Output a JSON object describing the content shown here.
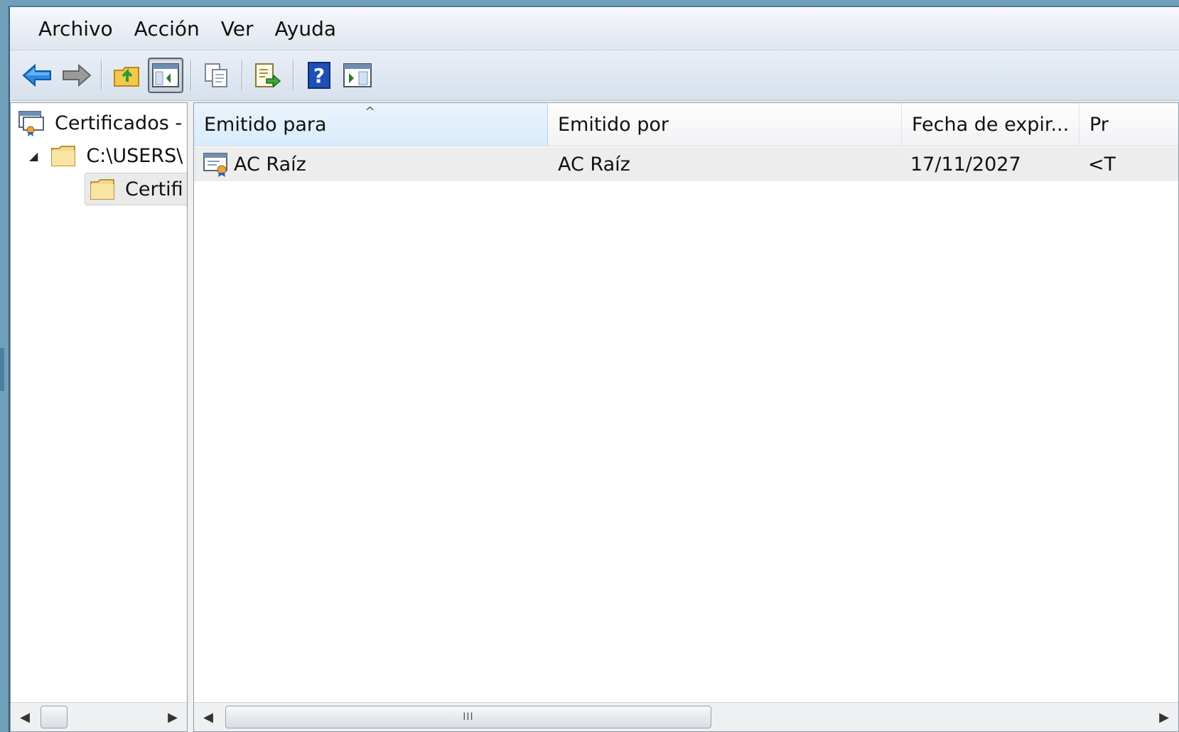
{
  "menu": [
    "Archivo",
    "Acción",
    "Ver",
    "Ayuda"
  ],
  "toolbar": {
    "icons": [
      "back-arrow-icon",
      "forward-arrow-icon",
      "up-folder-icon",
      "show-hide-tree-icon",
      "copy-icon",
      "export-list-icon",
      "help-icon",
      "show-hide-action-pane-icon"
    ]
  },
  "tree": {
    "root_label": "Certificados -",
    "store_label": "C:\\USERS\\",
    "folder_label": "Certifi"
  },
  "list": {
    "columns": [
      "Emitido para",
      "Emitido por",
      "Fecha de expir...",
      "Pr"
    ],
    "sort_indicator": "^",
    "rows": [
      {
        "issued_to": "AC Raíz",
        "issued_by": "AC Raíz",
        "expiration": "17/11/2027",
        "purpose": "<T"
      }
    ]
  },
  "scroll": {
    "thumb_grip": "III",
    "left_arrow": "◀",
    "right_arrow": "▶"
  },
  "colors": {
    "accent_blue": "#1e6fd1",
    "folder_yellow": "#f2d27a",
    "sorted_header": "#d9ecfb"
  }
}
